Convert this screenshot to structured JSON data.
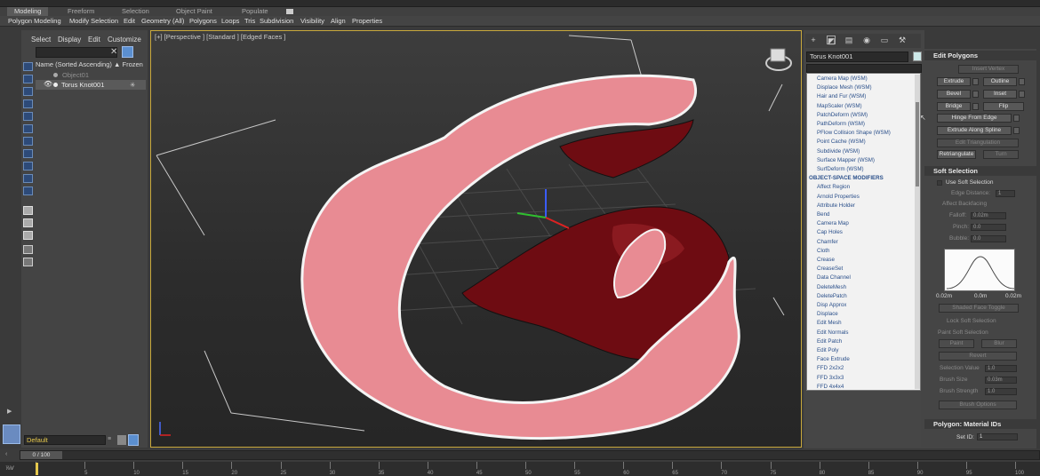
{
  "ribbon": {
    "tabs": [
      "Modeling",
      "Freeform",
      "Selection",
      "Object Paint",
      "Populate"
    ],
    "sub_items": [
      "Polygon Modeling",
      "Modify Selection",
      "Edit",
      "Geometry (All)",
      "Polygons",
      "Loops",
      "Tris",
      "Subdivision",
      "Visibility",
      "Align",
      "Properties"
    ]
  },
  "explorer": {
    "menu": [
      "Select",
      "Display",
      "Edit",
      "Customize"
    ],
    "column_name": "Name (Sorted Ascending)",
    "column_frozen": "▲ Frozen",
    "rows": [
      {
        "label": "Object01"
      },
      {
        "label": "Torus Knot001"
      }
    ]
  },
  "viewport": {
    "label": "[+] [Perspective ] [Standard ] [Edged Faces ]"
  },
  "command_panel": {
    "object_name": "Torus Knot001",
    "swatch_color": "#cce8e8",
    "modifier_list": [
      {
        "type": "item",
        "label": "Camera Map (WSM)"
      },
      {
        "type": "item",
        "label": "Displace Mesh (WSM)"
      },
      {
        "type": "item",
        "label": "Hair and Fur (WSM)"
      },
      {
        "type": "item",
        "label": "MapScaler (WSM)"
      },
      {
        "type": "item",
        "label": "PatchDeform (WSM)"
      },
      {
        "type": "item",
        "label": "PathDeform (WSM)"
      },
      {
        "type": "item",
        "label": "PFlow Collision Shape (WSM)"
      },
      {
        "type": "item",
        "label": "Point Cache (WSM)"
      },
      {
        "type": "item",
        "label": "Subdivide (WSM)"
      },
      {
        "type": "item",
        "label": "Surface Mapper (WSM)"
      },
      {
        "type": "item",
        "label": "SurfDeform (WSM)"
      },
      {
        "type": "header",
        "label": "OBJECT-SPACE MODIFIERS"
      },
      {
        "type": "item",
        "label": "Affect Region"
      },
      {
        "type": "item",
        "label": "Arnold Properties"
      },
      {
        "type": "item",
        "label": "Attribute Holder"
      },
      {
        "type": "item",
        "label": "Bend"
      },
      {
        "type": "item",
        "label": "Camera Map"
      },
      {
        "type": "item",
        "label": "Cap Holes"
      },
      {
        "type": "item",
        "label": "Chamfer"
      },
      {
        "type": "item",
        "label": "Cloth"
      },
      {
        "type": "item",
        "label": "Crease"
      },
      {
        "type": "item",
        "label": "CreaseSet"
      },
      {
        "type": "item",
        "label": "Data Channel"
      },
      {
        "type": "item",
        "label": "DeleteMesh"
      },
      {
        "type": "item",
        "label": "DeletePatch"
      },
      {
        "type": "item",
        "label": "Disp Approx"
      },
      {
        "type": "item",
        "label": "Displace"
      },
      {
        "type": "item",
        "label": "Edit Mesh"
      },
      {
        "type": "item",
        "label": "Edit Normals"
      },
      {
        "type": "item",
        "label": "Edit Patch"
      },
      {
        "type": "item",
        "label": "Edit Poly"
      },
      {
        "type": "item",
        "label": "Face Extrude"
      },
      {
        "type": "item",
        "label": "FFD 2x2x2"
      },
      {
        "type": "item",
        "label": "FFD 3x3x3"
      },
      {
        "type": "item",
        "label": "FFD 4x4x4"
      }
    ]
  },
  "edit_polygons": {
    "title": "Edit Polygons",
    "insert_vertex": "Insert Vertex",
    "extrude": "Extrude",
    "outline": "Outline",
    "bevel": "Bevel",
    "inset": "Inset",
    "bridge": "Bridge",
    "flip": "Flip",
    "hinge": "Hinge From Edge",
    "extrude_spline": "Extrude Along Spline",
    "edit_triangulation": "Edit Triangulation",
    "retriangulate": "Retriangulate",
    "turn": "Turn"
  },
  "soft_selection": {
    "title": "Soft Selection",
    "use_soft": "Use Soft Selection",
    "edge_distance": "Edge Distance:",
    "edge_distance_value": "1",
    "affect_backfacing": "Affect Backfacing",
    "falloff": "Falloff:",
    "falloff_value": "0.02m",
    "pinch": "Pinch:",
    "pinch_value": "0.0",
    "bubble": "Bubble:",
    "bubble_value": "0.0",
    "curve_left": "0.02m",
    "curve_mid": "0.0m",
    "curve_right": "0.02m",
    "shaded_toggle": "Shaded Face Toggle",
    "lock": "Lock Soft Selection",
    "paint_group": "Paint Soft Selection",
    "paint": "Paint",
    "blur": "Blur",
    "revert": "Revert",
    "selection_value": "Selection Value",
    "selection_value_v": "1.0",
    "brush_size": "Brush Size",
    "brush_size_v": "0.03m",
    "brush_strength": "Brush Strength",
    "brush_strength_v": "1.0",
    "brush_options": "Brush Options"
  },
  "material_ids": {
    "title": "Polygon: Material IDs",
    "set_id": "Set ID:",
    "set_id_value": "1"
  },
  "bottom": {
    "layer": "Default",
    "time_slider": "0 / 100",
    "ruler_ticks": [
      "0",
      "5",
      "10",
      "15",
      "20",
      "25",
      "30",
      "35",
      "40",
      "45",
      "50",
      "55",
      "60",
      "65",
      "70",
      "75",
      "80",
      "85",
      "90",
      "95",
      "100"
    ]
  }
}
